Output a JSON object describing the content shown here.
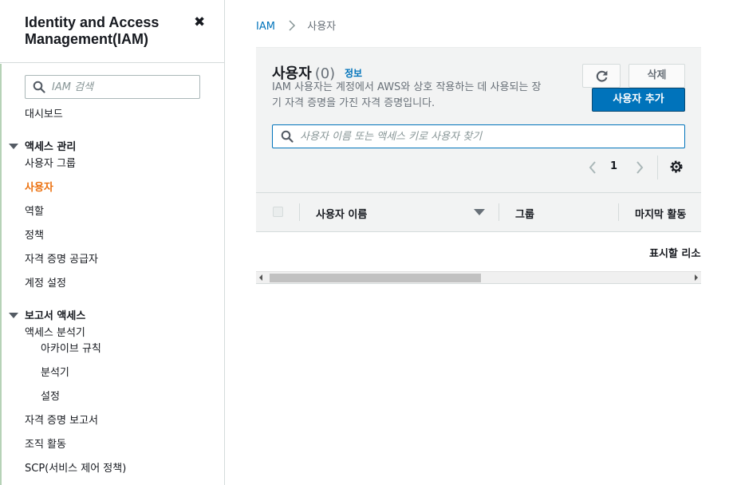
{
  "sidebar": {
    "title": "Identity and Access Management(IAM)",
    "close_symbol": "✖",
    "search_placeholder": "IAM 검색",
    "dashboard": "대시보드",
    "section_access": "액세스 관리",
    "access_items": [
      "사용자 그룹",
      "사용자",
      "역할",
      "정책",
      "자격 증명 공급자",
      "계정 설정"
    ],
    "active_item": "사용자",
    "section_reports": "보고서 액세스",
    "analyzer": "액세스 분석기",
    "analyzer_sub": [
      "아카이브 규칙",
      "분석기",
      "설정"
    ],
    "report_items": [
      "자격 증명 보고서",
      "조직 활동",
      "SCP(서비스 제어 정책)"
    ]
  },
  "breadcrumb": {
    "root": "IAM",
    "current": "사용자"
  },
  "panel": {
    "title": "사용자",
    "count": "(0)",
    "info_link": "정보",
    "description": "IAM 사용자는 계정에서 AWS와 상호 작용하는 데 사용되는 장기 자격 증명을 가진 자격 증명입니다.",
    "delete_label": "삭제",
    "add_label": "사용자 추가",
    "search_placeholder": "사용자 이름 또는 액세스 키로 사용자 찾기",
    "page_number": "1"
  },
  "table": {
    "columns": [
      "사용자 이름",
      "그룹",
      "마지막 활동"
    ],
    "empty_text": "표시할 리소스 없음"
  },
  "icons": {
    "search": "search-icon",
    "refresh": "refresh-icon",
    "settings": "gear-icon",
    "prev": "chevron-left-icon",
    "next": "chevron-right-icon"
  },
  "colors": {
    "accent_orange": "#ec7211",
    "link_blue": "#0073bb",
    "primary_button": "#0073bb",
    "panel_bg": "#f2f3f3"
  }
}
